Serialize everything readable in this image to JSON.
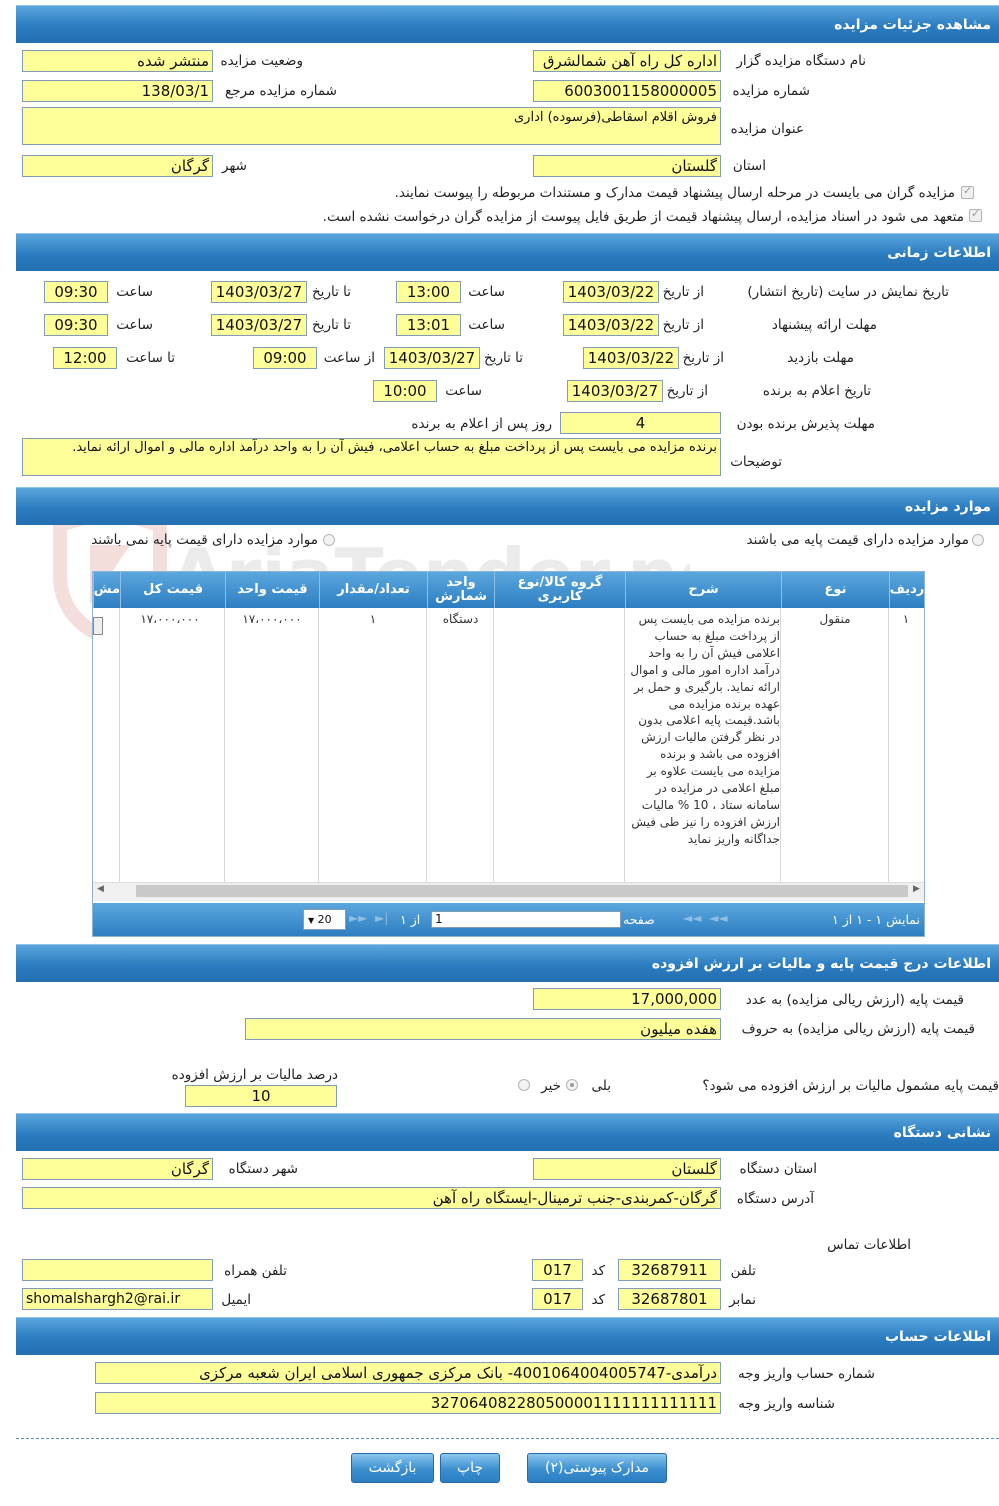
{
  "sections": {
    "details": "مشاهده جزئیات مزایده",
    "timing": "اطلاعات زمانی",
    "items": "موارد مزایده",
    "price": "اطلاعات درج قیمت پایه و مالیات بر ارزش افزوده",
    "address": "نشانی دستگاه",
    "account": "اطلاعات حساب"
  },
  "details": {
    "org_label": "نام دستگاه مزایده گزار",
    "org_value": "اداره کل راه آهن شمالشرق",
    "status_label": "وضعیت مزایده",
    "status_value": "منتشر شده",
    "number_label": "شماره مزایده",
    "number_value": "6003001158000005",
    "ref_label": "شماره مزایده مرجع",
    "ref_value": "138/03/1",
    "title_label": "عنوان مزایده",
    "title_value": "فروش اقلام اسقاطی(فرسوده) اداری",
    "province_label": "استان",
    "province_value": "گلستان",
    "city_label": "شهر",
    "city_value": "گرگان",
    "check1": "مزایده گران می بایست در مرحله ارسال پیشنهاد قیمت مدارک و مستندات مربوطه را پیوست نمایند.",
    "check2": "متعهد می شود در اسناد مزایده، ارسال پیشنهاد قیمت از طریق فایل پیوست از مزایده گران درخواست نشده است."
  },
  "timing": {
    "display_label": "تاریخ نمایش در سایت (تاریخ انتشار)",
    "from_date": "از تاریخ",
    "to_date": "تا تاریخ",
    "time": "ساعت",
    "from_time": "از ساعت",
    "to_time": "تا ساعت",
    "display_from": "1403/03/22",
    "display_from_time": "13:00",
    "display_to": "1403/03/27",
    "display_to_time": "09:30",
    "offer_label": "مهلت ارائه پیشنهاد",
    "offer_from": "1403/03/22",
    "offer_from_time": "13:01",
    "offer_to": "1403/03/27",
    "offer_to_time": "09:30",
    "visit_label": "مهلت بازدید",
    "visit_from": "1403/03/22",
    "visit_to": "1403/03/27",
    "visit_from_time": "09:00",
    "visit_to_time": "12:00",
    "winner_label": "تاریخ اعلام به برنده",
    "winner_date": "1403/03/27",
    "winner_time": "10:00",
    "accept_label": "مهلت پذیرش برنده بودن",
    "accept_days": "4",
    "accept_suffix": "روز پس از اعلام به برنده",
    "notes_label": "توضیحات",
    "notes_value": "برنده مزایده می بایست پس از پرداخت مبلغ به حساب اعلامی، فیش آن را به واحد درآمد اداره مالی و اموال ارائه نماید."
  },
  "items": {
    "radio_with_price": "موارد مزایده دارای قیمت پایه می باشند",
    "radio_without_price": "موارد مزایده دارای قیمت پایه نمی باشند",
    "columns": [
      "ردیف",
      "نوع",
      "شرح",
      "گروه کالا/نوع کاربری",
      "واحد شمارش",
      "تعداد/مقدار",
      "قیمت واحد",
      "قیمت کل",
      "مش"
    ],
    "rows": [
      {
        "row": "۱",
        "type": "منقول",
        "description": "برنده مزایده می بایست پس از پرداخت مبلغ به حساب اعلامی فیش آن را به واحد درآمد اداره امور مالی و اموال ارائه نماید. بارگیری و حمل بر عهده برنده مزایده می باشد.قیمت پایه اعلامی بدون در نظر گرفتن مالیات ارزش افزوده می باشد و برنده مزایده می بایست علاوه بر مبلغ اعلامی در مزایده در سامانه ستاد ، 10 % مالیات ارزش افزوده را نیز طی فیش جداگانه واریز نماید",
        "group": "",
        "unit": "دستگاه",
        "qty": "۱",
        "unit_price": "۱۷،۰۰۰،۰۰۰",
        "total": "۱۷،۰۰۰،۰۰۰"
      }
    ],
    "pager": {
      "page_label": "صفحه",
      "page_value": "1",
      "of_label": "از ۱",
      "page_size": "20",
      "summary": "نمایش ۱ - ۱ از ۱"
    }
  },
  "price": {
    "base_num_label": "قیمت پایه (ارزش ریالی مزایده) به عدد",
    "base_num_value": "17,000,000",
    "base_text_label": "قیمت پایه (ارزش ریالی مزایده) به حروف",
    "base_text_value": "هفده میلیون",
    "vat_question": "قیمت پایه مشمول مالیات بر ارزش افزوده می شود؟",
    "yes": "بلی",
    "no": "خیر",
    "vat_percent_label": "درصد مالیات بر ارزش افزوده",
    "vat_percent_value": "10"
  },
  "address": {
    "province_label": "استان دستگاه",
    "province_value": "گلستان",
    "city_label": "شهر دستگاه",
    "city_value": "گرگان",
    "address_label": "آدرس دستگاه",
    "address_value": "گرگان-کمربندی-جنب ترمینال-ایستگاه راه آهن",
    "contact_label": "اطلاعات تماس",
    "phone_label": "تلفن",
    "phone_value": "32687911",
    "code_label": "کد",
    "phone_code": "017",
    "mobile_label": "تلفن همراه",
    "mobile_value": "",
    "fax_label": "نمابر",
    "fax_value": "32687801",
    "fax_code": "017",
    "email_label": "ایمیل",
    "email_value": "shomalshargh2@rai.ir"
  },
  "account": {
    "account_label": "شماره حساب واریز وجه",
    "account_value": "درآمدی-4001064004005747- بانک مرکزی جمهوری اسلامی ایران شعبه مرکزی",
    "id_label": "شناسه واریز وجه",
    "id_value": "327064082280500001111111111111"
  },
  "buttons": {
    "attachments": "مدارک پیوستی(۲)",
    "print": "چاپ",
    "back": "بازگشت"
  },
  "watermark": "AriaTender.neT"
}
